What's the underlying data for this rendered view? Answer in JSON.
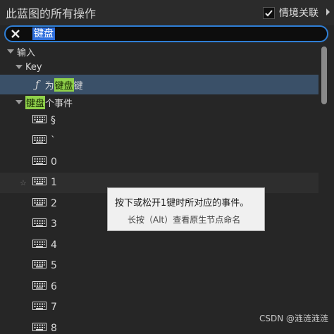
{
  "header": {
    "title": "此蓝图的所有操作",
    "context_sensitive_label": "情境关联",
    "context_sensitive_checked": true
  },
  "search": {
    "value": "键盘"
  },
  "tree": {
    "category_input": "输入",
    "subcategory_key": "Key",
    "func_item": {
      "prefix": "为",
      "highlight": "键盘",
      "suffix": "键"
    },
    "keyboard_events": {
      "highlight": "键盘",
      "suffix": "个事件"
    },
    "keys": [
      "§",
      "`",
      "0",
      "1",
      "2",
      "3",
      "4",
      "5",
      "6",
      "7",
      "8"
    ]
  },
  "tooltip": {
    "line1": "按下或松开1键时所对应的事件。",
    "line2": "长按（Alt）查看原生节点命名"
  },
  "watermark": "CSDN @涟涟涟涟",
  "colors": {
    "search_border": "#2f7fd6",
    "highlight": "#8fd14a",
    "selection": "#3a5068"
  }
}
